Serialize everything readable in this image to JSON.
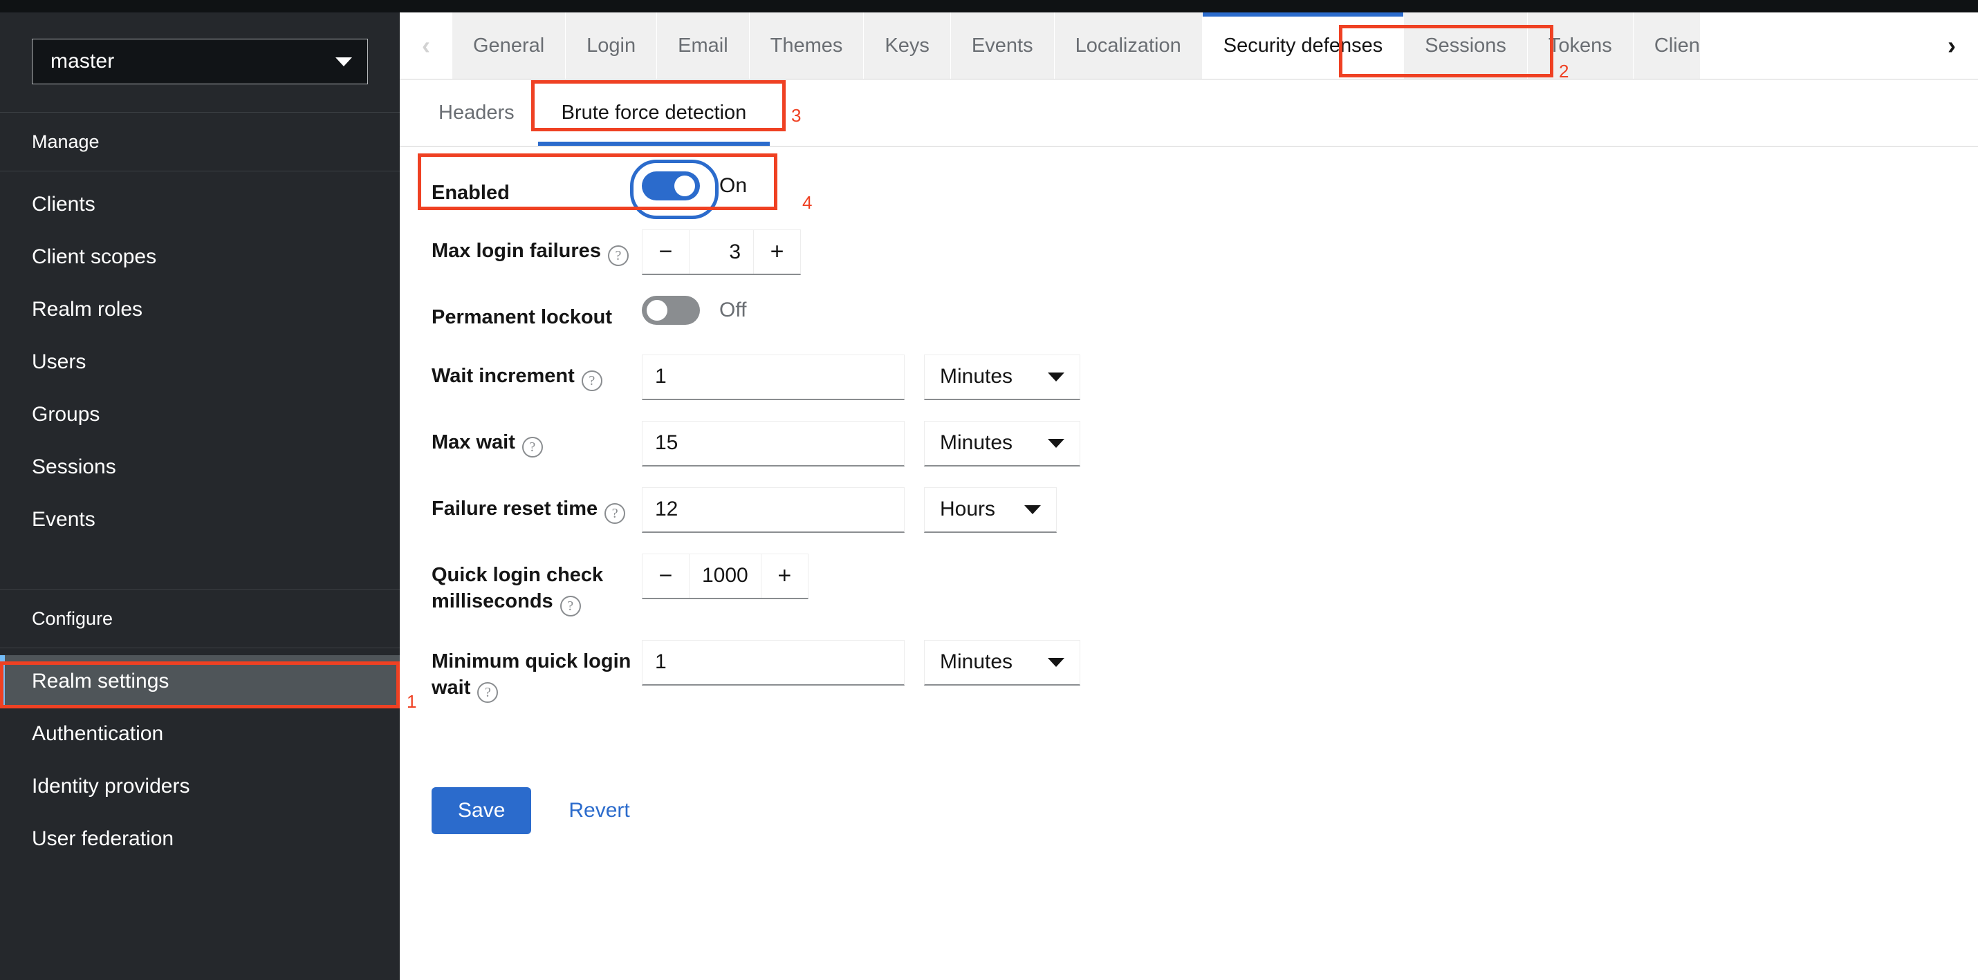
{
  "colors": {
    "accent_blue": "#2b6bcc",
    "sidebar_bg": "#25282c",
    "sidebar_active_bg": "#4f5559",
    "sidebar_accent": "#73bcf7",
    "annotation_red": "#ef4123",
    "toggle_off": "#8a8d90"
  },
  "sidebar": {
    "realm_selector": {
      "value": "master",
      "caret_icon": "chevron-down-icon"
    },
    "sections": [
      {
        "header": "Manage",
        "items": [
          {
            "label": "Clients",
            "active": false
          },
          {
            "label": "Client scopes",
            "active": false
          },
          {
            "label": "Realm roles",
            "active": false
          },
          {
            "label": "Users",
            "active": false
          },
          {
            "label": "Groups",
            "active": false
          },
          {
            "label": "Sessions",
            "active": false
          },
          {
            "label": "Events",
            "active": false
          }
        ]
      },
      {
        "header": "Configure",
        "items": [
          {
            "label": "Realm settings",
            "active": true
          },
          {
            "label": "Authentication",
            "active": false
          },
          {
            "label": "Identity providers",
            "active": false
          },
          {
            "label": "User federation",
            "active": false
          }
        ]
      }
    ]
  },
  "tabbar": {
    "scroll_left_icon": "chevron-left-icon",
    "scroll_right_icon": "chevron-right-icon",
    "tabs": [
      {
        "label": "General",
        "active": false
      },
      {
        "label": "Login",
        "active": false
      },
      {
        "label": "Email",
        "active": false
      },
      {
        "label": "Themes",
        "active": false
      },
      {
        "label": "Keys",
        "active": false
      },
      {
        "label": "Events",
        "active": false
      },
      {
        "label": "Localization",
        "active": false
      },
      {
        "label": "Security defenses",
        "active": true
      },
      {
        "label": "Sessions",
        "active": false
      },
      {
        "label": "Tokens",
        "active": false
      },
      {
        "label": "Clien",
        "active": false
      }
    ]
  },
  "subtabs": [
    {
      "label": "Headers",
      "active": false
    },
    {
      "label": "Brute force detection",
      "active": true
    }
  ],
  "form": {
    "enabled": {
      "label": "Enabled",
      "state_label": "On",
      "on": true
    },
    "max_login_failures": {
      "label": "Max login failures",
      "help_icon": "help-circle-icon",
      "value": "3",
      "minus_label": "−",
      "plus_label": "+"
    },
    "permanent_lockout": {
      "label": "Permanent lockout",
      "state_label": "Off",
      "on": false
    },
    "wait_increment": {
      "label": "Wait increment",
      "help_icon": "help-circle-icon",
      "value": "1",
      "unit": "Minutes"
    },
    "max_wait": {
      "label": "Max wait",
      "help_icon": "help-circle-icon",
      "value": "15",
      "unit": "Minutes"
    },
    "failure_reset_time": {
      "label": "Failure reset time",
      "help_icon": "help-circle-icon",
      "value": "12",
      "unit": "Hours"
    },
    "quick_login_check": {
      "label_line1": "Quick login check",
      "label_line2": "milliseconds",
      "help_icon": "help-circle-icon",
      "value": "1000",
      "minus_label": "−",
      "plus_label": "+"
    },
    "minimum_quick_login_wait": {
      "label_line1": "Minimum quick login",
      "label_line2": "wait",
      "help_icon": "help-circle-icon",
      "value": "1",
      "unit": "Minutes"
    },
    "save_label": "Save",
    "revert_label": "Revert"
  },
  "annotations": [
    {
      "num": "1"
    },
    {
      "num": "2"
    },
    {
      "num": "3"
    },
    {
      "num": "4"
    }
  ]
}
